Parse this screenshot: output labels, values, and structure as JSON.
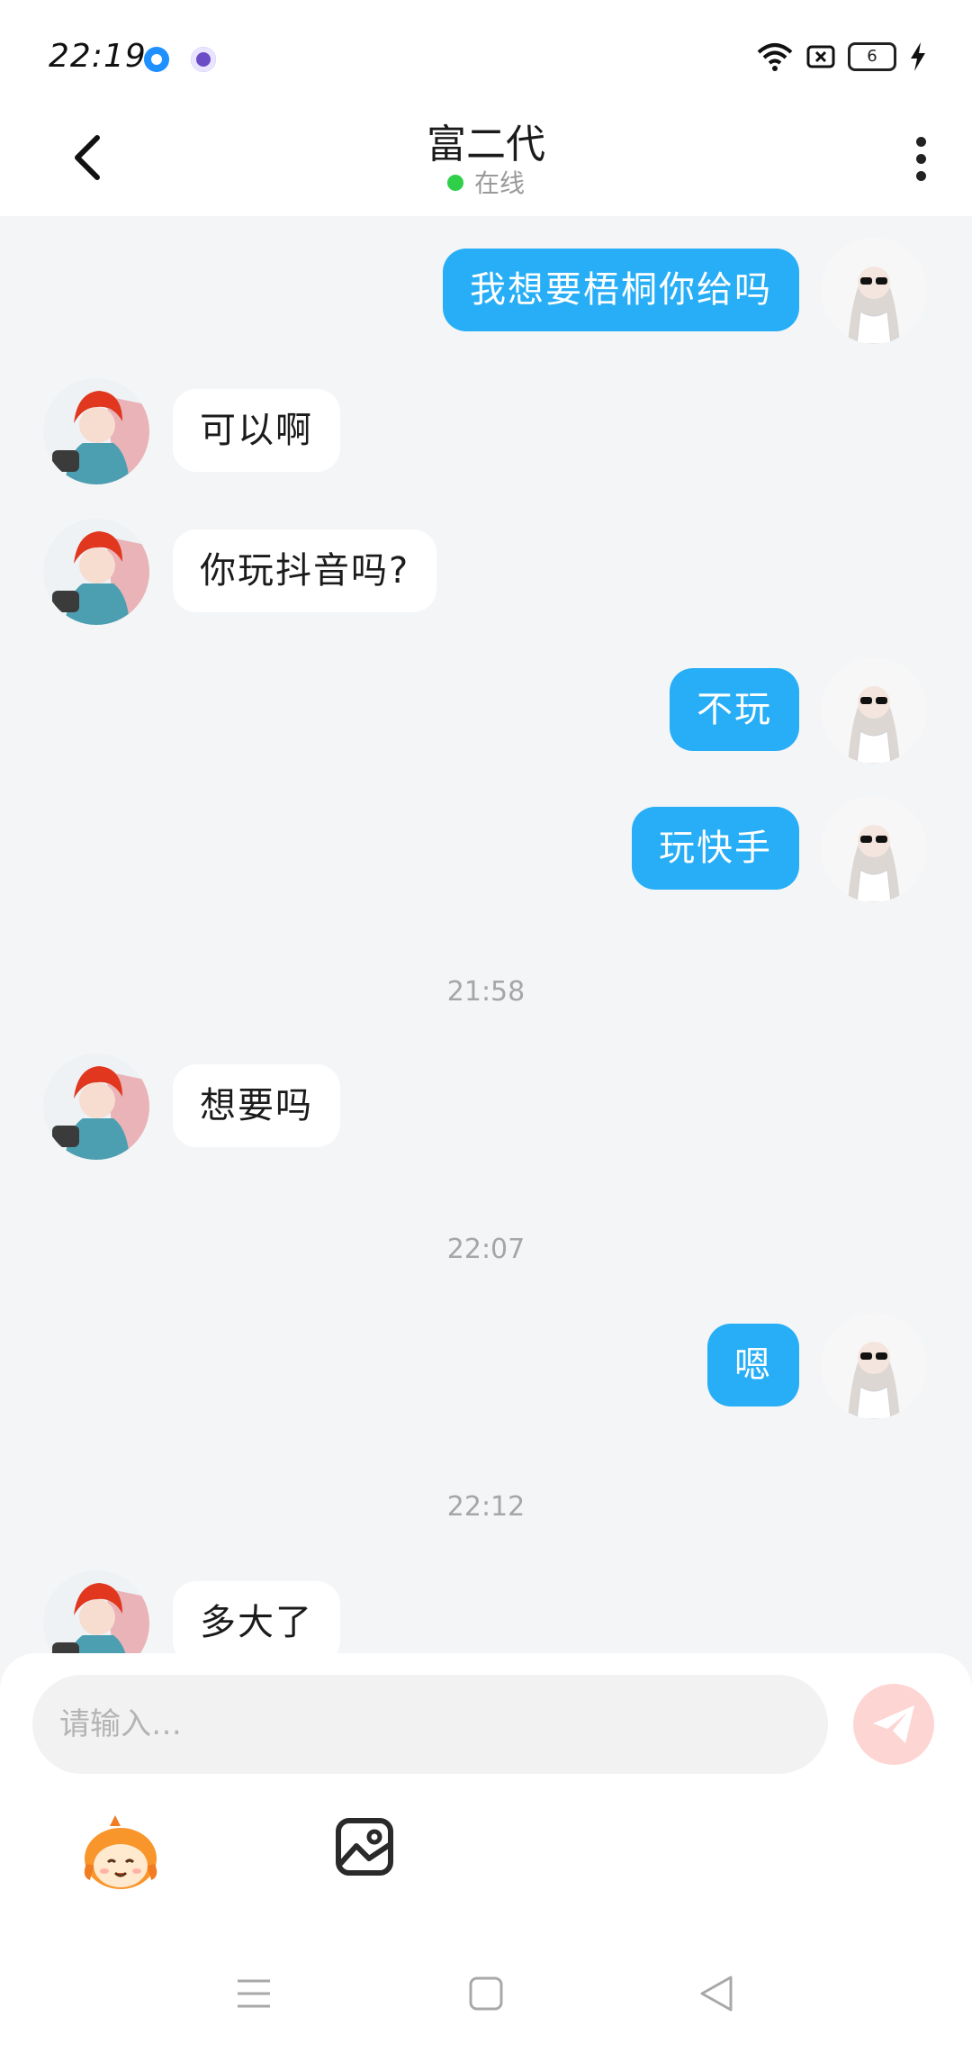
{
  "status_bar": {
    "time": "22:19",
    "battery_level": "6",
    "icons": [
      "app-notification-icon",
      "app-notification-icon",
      "wifi-icon",
      "sim-icon",
      "battery-icon",
      "charging-icon"
    ]
  },
  "header": {
    "title": "富二代",
    "status": "在线",
    "online_color": "#2fcf4a"
  },
  "messages": [
    {
      "side": "out",
      "text": "我想要梧桐你给吗"
    },
    {
      "side": "in",
      "text": "可以啊"
    },
    {
      "side": "in",
      "text": "你玩抖音吗?"
    },
    {
      "side": "out",
      "text": "不玩"
    },
    {
      "side": "out",
      "text": "玩快手"
    },
    {
      "timestamp": "21:58"
    },
    {
      "side": "in",
      "text": "想要吗"
    },
    {
      "timestamp": "22:07"
    },
    {
      "side": "out",
      "text": "嗯"
    },
    {
      "timestamp": "22:12"
    },
    {
      "side": "in",
      "text": "多大了"
    }
  ],
  "input": {
    "placeholder": "请输入…"
  },
  "colors": {
    "accent_blue": "#27aef6",
    "send_button": "#fdd6d3",
    "background": "#f4f5f7"
  }
}
